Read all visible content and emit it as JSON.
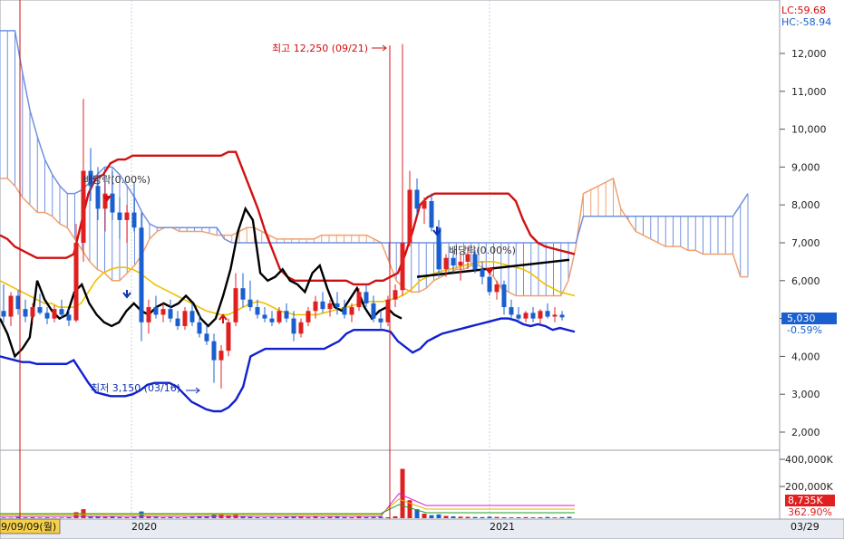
{
  "app": {
    "indicator_top": {
      "lc": "LC:59.68",
      "hc": "HC:-58.94"
    },
    "price_badge": {
      "value": "5,030",
      "change": "-0.59%",
      "bg": "#1a5fd0"
    },
    "volume_badge": {
      "value": "8,735K",
      "change": "362.90%",
      "bg": "#e02020"
    },
    "date_labels": {
      "left": "9/09/09(월)",
      "right": "03/29"
    }
  },
  "chart_data": {
    "type": "line",
    "title": "",
    "price_axis": {
      "ticks": [
        "12,000",
        "11,000",
        "10,000",
        "9,000",
        "8,000",
        "7,000",
        "6,000",
        "5,000",
        "4,000",
        "3,000",
        "2,000"
      ],
      "ylim": [
        1800,
        12500
      ]
    },
    "volume_axis": {
      "ticks": [
        "400,000K",
        "200,000K"
      ],
      "ylim": [
        0,
        400000
      ]
    },
    "x_axis_labels": [
      "2020",
      "2021"
    ],
    "annotations": [
      {
        "text": "최고 12,250 (09/21)",
        "color": "#d01010"
      },
      {
        "text": "최저 3,150 (03/16)",
        "color": "#1030b0"
      },
      {
        "text": "배당락(0.00%)",
        "color": "#333333",
        "id": "div1"
      },
      {
        "text": "배당락(0.00%)",
        "color": "#333333",
        "id": "div2"
      }
    ],
    "colors": {
      "up": "#e02020",
      "down": "#1a5fd0",
      "upper_band": "#d01010",
      "lower_band": "#1020d0",
      "ma_yellow": "#f0c000",
      "ma_black": "#000000",
      "cloud_span_a": "#f0a070",
      "cloud_span_b": "#7090e0"
    },
    "candles": [
      {
        "o": 5200,
        "h": 5900,
        "l": 4900,
        "c": 5050
      },
      {
        "o": 5050,
        "h": 5700,
        "l": 4800,
        "c": 5600
      },
      {
        "o": 5600,
        "h": 5750,
        "l": 5100,
        "c": 5250
      },
      {
        "o": 5250,
        "h": 5500,
        "l": 4900,
        "c": 5050
      },
      {
        "o": 5050,
        "h": 5400,
        "l": 4900,
        "c": 5300
      },
      {
        "o": 5300,
        "h": 5650,
        "l": 5100,
        "c": 5150
      },
      {
        "o": 5150,
        "h": 5300,
        "l": 4850,
        "c": 5000
      },
      {
        "o": 5000,
        "h": 5350,
        "l": 4900,
        "c": 5250
      },
      {
        "o": 5250,
        "h": 5500,
        "l": 5000,
        "c": 5100
      },
      {
        "o": 5100,
        "h": 5250,
        "l": 4800,
        "c": 4950
      },
      {
        "o": 4950,
        "h": 7500,
        "l": 4900,
        "c": 7000
      },
      {
        "o": 7000,
        "h": 10800,
        "l": 6500,
        "c": 8900
      },
      {
        "o": 8900,
        "h": 9500,
        "l": 8100,
        "c": 8500
      },
      {
        "o": 8500,
        "h": 9000,
        "l": 7600,
        "c": 7900
      },
      {
        "o": 7900,
        "h": 8600,
        "l": 7300,
        "c": 8300
      },
      {
        "o": 8300,
        "h": 8900,
        "l": 7600,
        "c": 7800
      },
      {
        "o": 7800,
        "h": 8200,
        "l": 7100,
        "c": 7600
      },
      {
        "o": 7600,
        "h": 8000,
        "l": 7000,
        "c": 7800
      },
      {
        "o": 7800,
        "h": 8600,
        "l": 7300,
        "c": 7400
      },
      {
        "o": 7400,
        "h": 7800,
        "l": 4400,
        "c": 4900
      },
      {
        "o": 4900,
        "h": 5500,
        "l": 4600,
        "c": 5300
      },
      {
        "o": 5300,
        "h": 5600,
        "l": 5000,
        "c": 5100
      },
      {
        "o": 5100,
        "h": 5400,
        "l": 4900,
        "c": 5250
      },
      {
        "o": 5250,
        "h": 5500,
        "l": 4900,
        "c": 5000
      },
      {
        "o": 5000,
        "h": 5200,
        "l": 4700,
        "c": 4800
      },
      {
        "o": 4800,
        "h": 5300,
        "l": 4700,
        "c": 5200
      },
      {
        "o": 5200,
        "h": 5400,
        "l": 4800,
        "c": 4900
      },
      {
        "o": 4900,
        "h": 5100,
        "l": 4500,
        "c": 4600
      },
      {
        "o": 4600,
        "h": 4800,
        "l": 4300,
        "c": 4400
      },
      {
        "o": 4400,
        "h": 4600,
        "l": 3300,
        "c": 3900
      },
      {
        "o": 3900,
        "h": 4300,
        "l": 3150,
        "c": 4150
      },
      {
        "o": 4150,
        "h": 5000,
        "l": 4000,
        "c": 4900
      },
      {
        "o": 4900,
        "h": 6200,
        "l": 4800,
        "c": 5800
      },
      {
        "o": 5800,
        "h": 6200,
        "l": 5300,
        "c": 5500
      },
      {
        "o": 5500,
        "h": 6000,
        "l": 5200,
        "c": 5300
      },
      {
        "o": 5300,
        "h": 5500,
        "l": 5000,
        "c": 5100
      },
      {
        "o": 5100,
        "h": 5300,
        "l": 4900,
        "c": 5000
      },
      {
        "o": 5000,
        "h": 5200,
        "l": 4800,
        "c": 4900
      },
      {
        "o": 4900,
        "h": 5300,
        "l": 4850,
        "c": 5200
      },
      {
        "o": 5200,
        "h": 5400,
        "l": 4900,
        "c": 5000
      },
      {
        "o": 5000,
        "h": 5200,
        "l": 4400,
        "c": 4600
      },
      {
        "o": 4600,
        "h": 5000,
        "l": 4500,
        "c": 4900
      },
      {
        "o": 4900,
        "h": 5300,
        "l": 4800,
        "c": 5200
      },
      {
        "o": 5200,
        "h": 5600,
        "l": 5000,
        "c": 5450
      },
      {
        "o": 5450,
        "h": 5700,
        "l": 5150,
        "c": 5250
      },
      {
        "o": 5250,
        "h": 5500,
        "l": 5050,
        "c": 5400
      },
      {
        "o": 5400,
        "h": 5700,
        "l": 5100,
        "c": 5300
      },
      {
        "o": 5300,
        "h": 5500,
        "l": 5000,
        "c": 5100
      },
      {
        "o": 5100,
        "h": 5400,
        "l": 4900,
        "c": 5300
      },
      {
        "o": 5300,
        "h": 5800,
        "l": 5200,
        "c": 5700
      },
      {
        "o": 5700,
        "h": 5900,
        "l": 5300,
        "c": 5400
      },
      {
        "o": 5400,
        "h": 5600,
        "l": 4900,
        "c": 5000
      },
      {
        "o": 5000,
        "h": 5200,
        "l": 4700,
        "c": 4900
      },
      {
        "o": 4900,
        "h": 5600,
        "l": 4800,
        "c": 5500
      },
      {
        "o": 5500,
        "h": 5900,
        "l": 5300,
        "c": 5750
      },
      {
        "o": 5750,
        "h": 12250,
        "l": 5600,
        "c": 7000
      },
      {
        "o": 7000,
        "h": 8900,
        "l": 6900,
        "c": 8400
      },
      {
        "o": 8400,
        "h": 8700,
        "l": 7700,
        "c": 7900
      },
      {
        "o": 7900,
        "h": 8200,
        "l": 7500,
        "c": 8100
      },
      {
        "o": 8100,
        "h": 8300,
        "l": 7300,
        "c": 7400
      },
      {
        "o": 7400,
        "h": 7600,
        "l": 6100,
        "c": 6300
      },
      {
        "o": 6300,
        "h": 6700,
        "l": 6100,
        "c": 6600
      },
      {
        "o": 6600,
        "h": 6800,
        "l": 6200,
        "c": 6400
      },
      {
        "o": 6400,
        "h": 6700,
        "l": 6000,
        "c": 6500
      },
      {
        "o": 6500,
        "h": 6900,
        "l": 6300,
        "c": 6700
      },
      {
        "o": 6700,
        "h": 6800,
        "l": 6200,
        "c": 6300
      },
      {
        "o": 6300,
        "h": 6500,
        "l": 5900,
        "c": 6100
      },
      {
        "o": 6100,
        "h": 6300,
        "l": 5600,
        "c": 5700
      },
      {
        "o": 5700,
        "h": 6000,
        "l": 5500,
        "c": 5900
      },
      {
        "o": 5900,
        "h": 6000,
        "l": 5100,
        "c": 5300
      },
      {
        "o": 5300,
        "h": 5500,
        "l": 5000,
        "c": 5100
      },
      {
        "o": 5100,
        "h": 5300,
        "l": 4900,
        "c": 5000
      },
      {
        "o": 5000,
        "h": 5200,
        "l": 4900,
        "c": 5150
      },
      {
        "o": 5150,
        "h": 5300,
        "l": 4900,
        "c": 5000
      },
      {
        "o": 5000,
        "h": 5250,
        "l": 4850,
        "c": 5200
      },
      {
        "o": 5200,
        "h": 5400,
        "l": 5000,
        "c": 5050
      },
      {
        "o": 5050,
        "h": 5300,
        "l": 4900,
        "c": 5100
      },
      {
        "o": 5100,
        "h": 5200,
        "l": 4950,
        "c": 5030
      }
    ],
    "volume": [
      4,
      3,
      8,
      5,
      6,
      4,
      5,
      3,
      4,
      6,
      40,
      60,
      12,
      10,
      8,
      9,
      7,
      6,
      8,
      45,
      10,
      8,
      6,
      7,
      5,
      6,
      8,
      9,
      12,
      30,
      22,
      18,
      25,
      10,
      8,
      6,
      5,
      7,
      6,
      8,
      14,
      9,
      7,
      10,
      6,
      8,
      12,
      7,
      6,
      9,
      7,
      8,
      10,
      6,
      12,
      330,
      120,
      60,
      30,
      20,
      25,
      15,
      12,
      10,
      9,
      8,
      7,
      10,
      8,
      6,
      5,
      6,
      7,
      5,
      6,
      8,
      5,
      7,
      9
    ],
    "upper_band": [
      7200,
      7100,
      6900,
      6800,
      6700,
      6600,
      6600,
      6600,
      6600,
      6600,
      6700,
      7500,
      8300,
      8700,
      8800,
      9100,
      9200,
      9200,
      9300,
      9300,
      9300,
      9300,
      9300,
      9300,
      9300,
      9300,
      9300,
      9300,
      9300,
      9300,
      9300,
      9400,
      9400,
      8900,
      8400,
      7900,
      7300,
      6800,
      6300,
      6100,
      6000,
      6000,
      6000,
      6000,
      6000,
      6000,
      6000,
      6000,
      5900,
      5900,
      5900,
      6000,
      6000,
      6100,
      6200,
      6700,
      7300,
      8000,
      8200,
      8300,
      8300,
      8300,
      8300,
      8300,
      8300,
      8300,
      8300,
      8300,
      8300,
      8300,
      8100,
      7600,
      7200,
      7000,
      6900,
      6850,
      6800,
      6750,
      6700
    ],
    "lower_band": [
      4000,
      3950,
      3900,
      3850,
      3850,
      3800,
      3800,
      3800,
      3800,
      3800,
      3900,
      3600,
      3300,
      3050,
      3000,
      2950,
      2950,
      2950,
      3000,
      3100,
      3250,
      3300,
      3300,
      3300,
      3200,
      3000,
      2800,
      2700,
      2600,
      2550,
      2550,
      2650,
      2850,
      3200,
      4000,
      4100,
      4200,
      4200,
      4200,
      4200,
      4200,
      4200,
      4200,
      4200,
      4200,
      4300,
      4400,
      4600,
      4700,
      4700,
      4700,
      4700,
      4700,
      4650,
      4400,
      4250,
      4100,
      4200,
      4400,
      4500,
      4600,
      4650,
      4700,
      4750,
      4800,
      4850,
      4900,
      4950,
      5000,
      5000,
      4950,
      4850,
      4800,
      4850,
      4800,
      4700,
      4750,
      4700,
      4650
    ],
    "ma_yellow": [
      6000,
      5900,
      5800,
      5700,
      5600,
      5500,
      5400,
      5400,
      5300,
      5300,
      5300,
      5400,
      5700,
      6000,
      6200,
      6300,
      6350,
      6350,
      6300,
      6200,
      6050,
      5900,
      5800,
      5700,
      5600,
      5500,
      5400,
      5300,
      5200,
      5150,
      5100,
      5100,
      5200,
      5300,
      5400,
      5450,
      5400,
      5300,
      5200,
      5150,
      5100,
      5100,
      5100,
      5100,
      5150,
      5200,
      5250,
      5300,
      5350,
      5400,
      5450,
      5450,
      5450,
      5500,
      5550,
      5650,
      5800,
      6000,
      6100,
      6200,
      6250,
      6300,
      6350,
      6400,
      6450,
      6500,
      6500,
      6500,
      6450,
      6400,
      6350,
      6300,
      6200,
      6050,
      5900,
      5800,
      5700,
      5650,
      5600
    ],
    "ma_black": [
      5000,
      4600,
      4000,
      4200,
      4500,
      6000,
      5500,
      5200,
      5000,
      5100,
      5700,
      5900,
      5400,
      5100,
      4900,
      4800,
      4900,
      5200,
      5400,
      5200,
      5100,
      5300,
      5400,
      5300,
      5400,
      5600,
      5400,
      5000,
      4800,
      5000,
      5600,
      6300,
      7300,
      7900,
      7600,
      6200,
      6000,
      6100,
      6300,
      6000,
      5900,
      5700,
      6200,
      6400,
      5800,
      5300,
      5200,
      5500,
      5800,
      5300,
      5000,
      5200,
      5300,
      5100,
      5000
    ],
    "trend_line": {
      "from": [
        6100,
        57
      ],
      "to": [
        6550,
        78
      ]
    },
    "cloud_span_a": [
      8700,
      8700,
      8500,
      8200,
      8000,
      7800,
      7800,
      7700,
      7500,
      7400,
      7100,
      6800,
      6500,
      6300,
      6200,
      6000,
      6000,
      6200,
      6400,
      6700,
      7100,
      7300,
      7400,
      7400,
      7300,
      7300,
      7300,
      7300,
      7250,
      7200,
      7200,
      7200,
      7300,
      7400,
      7400,
      7300,
      7200,
      7100,
      7100,
      7100,
      7100,
      7100,
      7100,
      7200,
      7200,
      7200,
      7200,
      7200,
      7200,
      7200,
      7100,
      7000,
      6500,
      6000,
      5800,
      5700,
      5700,
      5800,
      6000,
      6100,
      6200,
      6300,
      6300,
      6400,
      6400,
      6300,
      6100,
      5800,
      5700,
      5600,
      5600,
      5600,
      5600,
      5600,
      5600,
      5600,
      6000,
      6900,
      8300,
      8400,
      8500,
      8600,
      8700,
      7900,
      7600,
      7300,
      7200,
      7100,
      7000,
      6900,
      6900,
      6900,
      6800,
      6800,
      6700,
      6700,
      6700,
      6700,
      6700,
      6100,
      6100
    ],
    "cloud_span_b": [
      12600,
      12600,
      12600,
      11500,
      10500,
      9800,
      9200,
      8800,
      8500,
      8300,
      8300,
      8400,
      8600,
      8800,
      9000,
      9000,
      8800,
      8500,
      8200,
      7800,
      7500,
      7400,
      7400,
      7400,
      7400,
      7400,
      7400,
      7400,
      7400,
      7400,
      7100,
      7000,
      7000,
      7000,
      7000,
      7000,
      7000,
      7000,
      7000,
      7000,
      7000,
      7000,
      7000,
      7000,
      7000,
      7000,
      7000,
      7000,
      7000,
      7000,
      7000,
      7000,
      7000,
      7000,
      7000,
      7000,
      7000,
      7000,
      7000,
      7000,
      7000,
      7000,
      7000,
      7000,
      7000,
      7000,
      7000,
      7000,
      7000,
      7000,
      7000,
      7000,
      7000,
      7000,
      7000,
      7000,
      7000,
      7000,
      7700,
      7700,
      7700,
      7700,
      7700,
      7700,
      7700,
      7700,
      7700,
      7700,
      7700,
      7700,
      7700,
      7700,
      7700,
      7700,
      7700,
      7700,
      7700,
      7700,
      7700,
      8000,
      8300
    ]
  }
}
